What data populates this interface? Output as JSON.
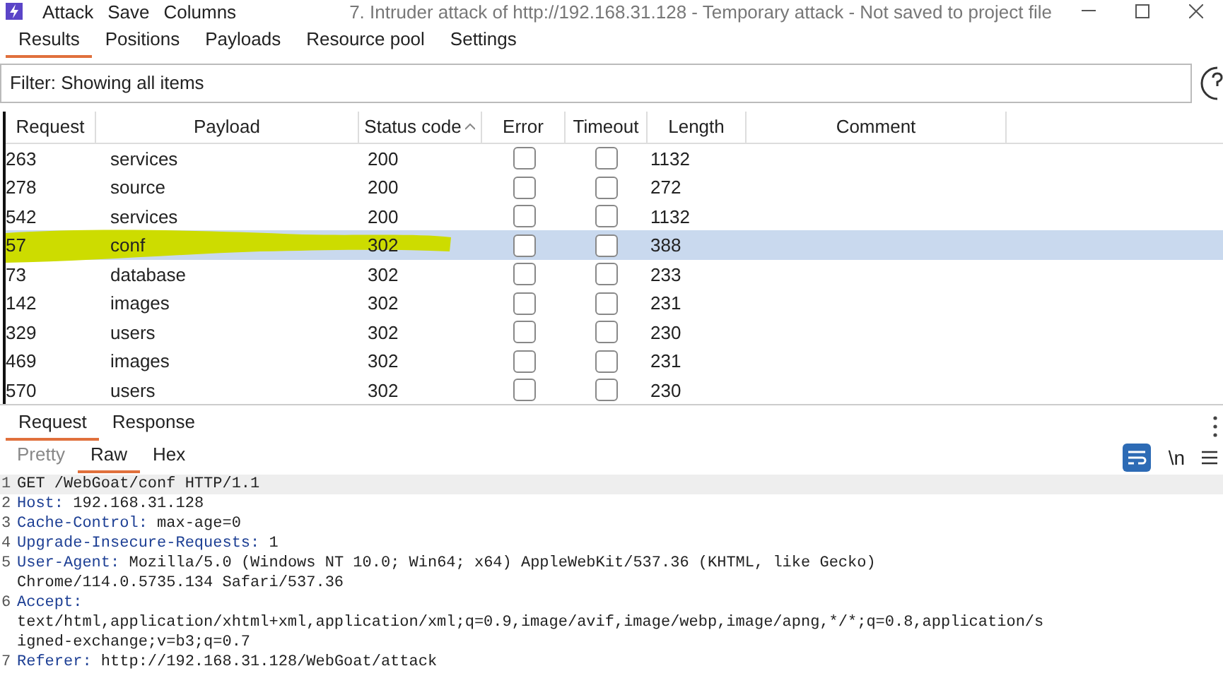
{
  "menu": [
    "Attack",
    "Save",
    "Columns"
  ],
  "window": {
    "title": "7. Intruder attack of http://192.168.31.128 - Temporary attack - Not saved to project file"
  },
  "tabs": [
    {
      "label": "Results",
      "selected": true
    },
    {
      "label": "Positions",
      "selected": false
    },
    {
      "label": "Payloads",
      "selected": false
    },
    {
      "label": "Resource pool",
      "selected": false
    },
    {
      "label": "Settings",
      "selected": false
    }
  ],
  "filter": {
    "label": "Filter: Showing all items"
  },
  "table": {
    "columns": [
      "Request",
      "Payload",
      "Status code",
      "Error",
      "Timeout",
      "Length",
      "Comment"
    ],
    "rows": [
      {
        "request": "263",
        "payload": "services",
        "status": "200",
        "error": false,
        "timeout": false,
        "length": "1132",
        "selected": false,
        "marked": false
      },
      {
        "request": "278",
        "payload": "source",
        "status": "200",
        "error": false,
        "timeout": false,
        "length": "272",
        "selected": false,
        "marked": false
      },
      {
        "request": "542",
        "payload": "services",
        "status": "200",
        "error": false,
        "timeout": false,
        "length": "1132",
        "selected": false,
        "marked": false
      },
      {
        "request": "57",
        "payload": "conf",
        "status": "302",
        "error": false,
        "timeout": false,
        "length": "388",
        "selected": true,
        "marked": true
      },
      {
        "request": "73",
        "payload": "database",
        "status": "302",
        "error": false,
        "timeout": false,
        "length": "233",
        "selected": false,
        "marked": false
      },
      {
        "request": "142",
        "payload": "images",
        "status": "302",
        "error": false,
        "timeout": false,
        "length": "231",
        "selected": false,
        "marked": false
      },
      {
        "request": "329",
        "payload": "users",
        "status": "302",
        "error": false,
        "timeout": false,
        "length": "230",
        "selected": false,
        "marked": false
      },
      {
        "request": "469",
        "payload": "images",
        "status": "302",
        "error": false,
        "timeout": false,
        "length": "231",
        "selected": false,
        "marked": false
      },
      {
        "request": "570",
        "payload": "users",
        "status": "302",
        "error": false,
        "timeout": false,
        "length": "230",
        "selected": false,
        "marked": false
      }
    ]
  },
  "detail_tabs": [
    {
      "label": "Request",
      "selected": true
    },
    {
      "label": "Response",
      "selected": false
    }
  ],
  "view_tabs": [
    {
      "label": "Pretty",
      "selected": false
    },
    {
      "label": "Raw",
      "selected": true
    },
    {
      "label": "Hex",
      "selected": false
    }
  ],
  "newline_toggle": "\\n",
  "code": [
    {
      "number": "1",
      "value_lines": [
        "GET /WebGoat/conf HTTP/1.1"
      ],
      "current": true
    },
    {
      "number": "2",
      "name": "Host:",
      "value_lines": [
        "192.168.31.128"
      ],
      "current": false
    },
    {
      "number": "3",
      "name": "Cache-Control:",
      "value_lines": [
        "max-age=0"
      ],
      "current": false
    },
    {
      "number": "4",
      "name": "Upgrade-Insecure-Requests:",
      "value_lines": [
        "1"
      ],
      "current": false
    },
    {
      "number": "5",
      "name": "User-Agent:",
      "value_lines": [
        "Mozilla/5.0 (Windows NT 10.0; Win64; x64) AppleWebKit/537.36 (KHTML, like Gecko)",
        "Chrome/114.0.5735.134 Safari/537.36"
      ],
      "current": false
    },
    {
      "number": "6",
      "name": "Accept:",
      "break_after_name": true,
      "value_lines": [
        "text/html,application/xhtml+xml,application/xml;q=0.9,image/avif,image/webp,image/apng,*/*;q=0.8,application/s",
        "igned-exchange;v=b3;q=0.7"
      ],
      "current": false
    },
    {
      "number": "7",
      "name": "Referer:",
      "value_lines": [
        "http://192.168.31.128/WebGoat/attack"
      ],
      "current": false
    }
  ]
}
